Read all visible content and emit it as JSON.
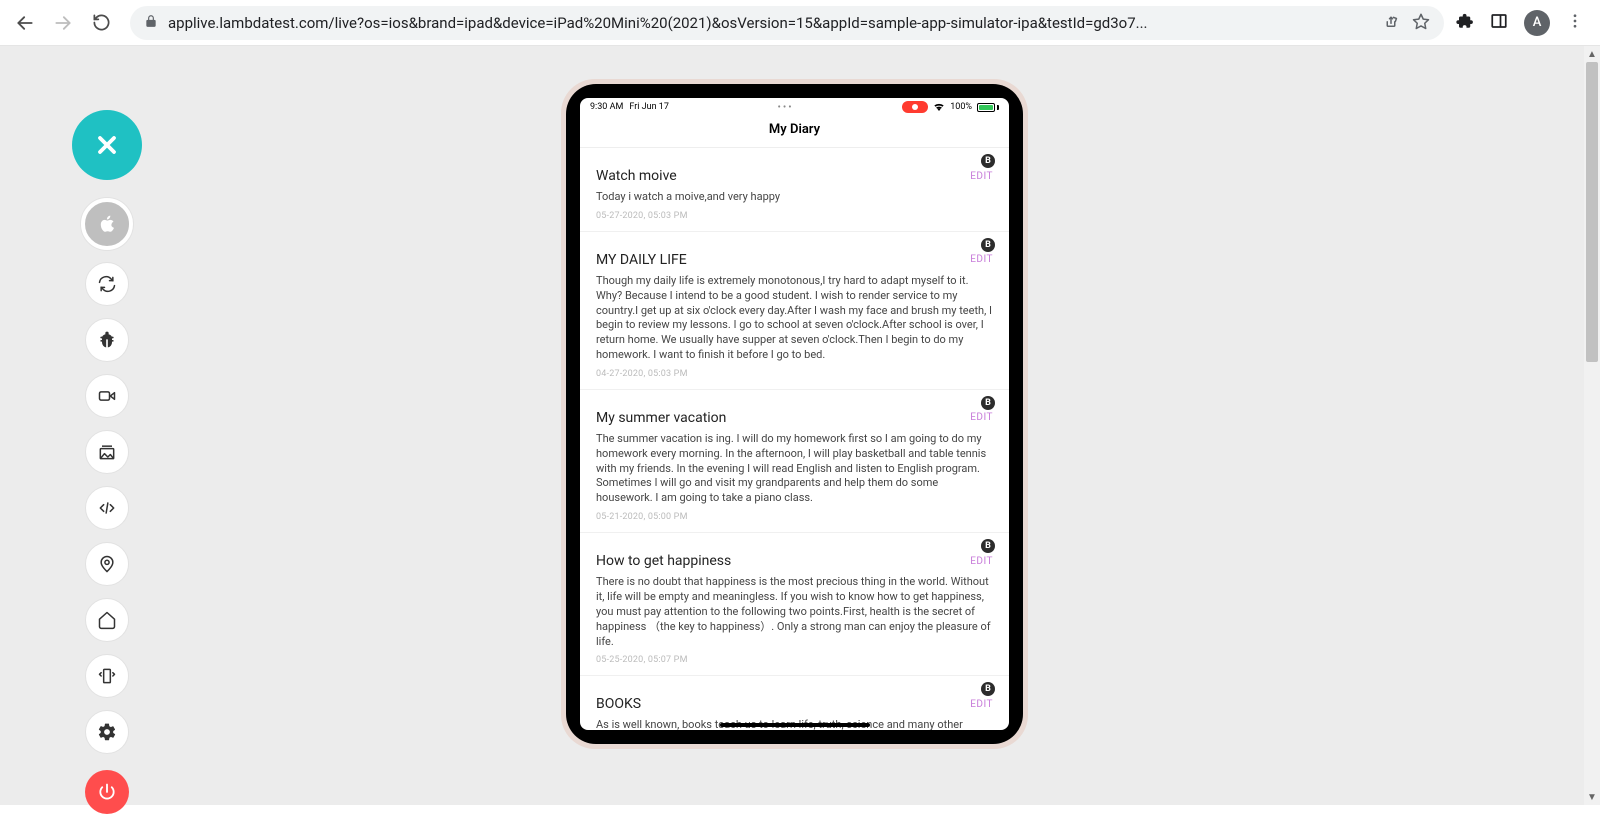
{
  "browser": {
    "url": "applive.lambdatest.com/live?os=ios&brand=ipad&device=iPad%20Mini%20(2021)&osVersion=15&appId=sample-app-simulator-ipa&testId=gd3o7...",
    "avatar_initial": "A"
  },
  "status": {
    "time": "9:30 AM",
    "date": "Fri Jun 17",
    "wifi_pct": "100%"
  },
  "app": {
    "title": "My Diary",
    "edit_label": "EDIT",
    "badge": "B"
  },
  "entries": [
    {
      "title": "Watch moive",
      "body": "Today i watch a moive,and very happy",
      "time": "05-27-2020, 05:03 PM"
    },
    {
      "title": "MY DAILY LIFE",
      "body": "Though my daily life is extremely monotonous,I try hard to adapt myself to it. Why? Because I intend to be a good student. I wish to render service to my country.I get up at six o'clock every day.After I wash my face and brush my teeth, I begin to review my lessons. I go to school at seven o'clock.After school is over, I return home. We usually have supper at seven o'clock.Then I begin to do my homework. I want to finish it before I go to bed.",
      "time": "04-27-2020, 05:03 PM"
    },
    {
      "title": "My summer vacation",
      "body": "The summer vacation is ing. I will do my homework first so I am going to do my homework every morning. In the afternoon, I will play basketball and table tennis with my friends. In the evening I will read English and listen to English program. Sometimes I will go and visit my grandparents and help them do some housework. I am going to take a piano class.",
      "time": "05-21-2020, 05:00 PM"
    },
    {
      "title": "How to get happiness",
      "body": "There is no doubt that happiness is the most precious thing in the world. Without it, life will be empty and meaningless. If you wish to know how to get happiness, you must pay attention to the following two points.First, health is the secret of happiness （the key to happiness）. Only a strong man can enjoy the pleasure of life.",
      "time": "05-25-2020, 05:07 PM"
    },
    {
      "title": "BOOKS",
      "body": "As is well known, books teach us to learn life, truth, science and many other",
      "time": ""
    }
  ]
}
